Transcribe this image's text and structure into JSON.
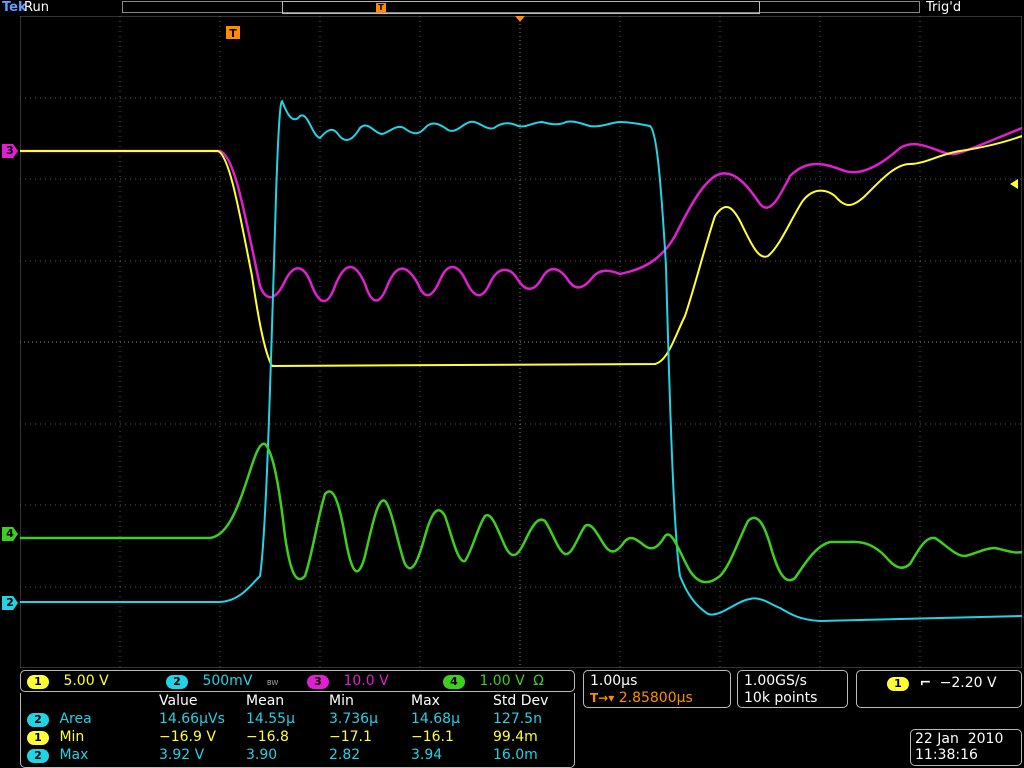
{
  "header": {
    "brand": "Tek",
    "run_state": "Run",
    "trigger_state": "Trig'd",
    "trigger_marker": "T"
  },
  "channels": [
    {
      "id": "1",
      "color": "#ffff33",
      "scale": "5.00 V"
    },
    {
      "id": "2",
      "color": "#22d3e6",
      "scale": "500mV",
      "bw": "BW"
    },
    {
      "id": "3",
      "color": "#e01fd0",
      "scale": "10.0 V"
    },
    {
      "id": "4",
      "color": "#3fce1f",
      "scale": "1.00 V",
      "unit": "Ω"
    }
  ],
  "measurements": {
    "headers": [
      "Value",
      "Mean",
      "Min",
      "Max",
      "Std Dev"
    ],
    "rows": [
      {
        "ch": "2",
        "name": "Area",
        "value": "14.66µVs",
        "mean": "14.55µ",
        "min": "3.736µ",
        "max": "14.68µ",
        "std": "127.5n"
      },
      {
        "ch": "1",
        "name": "Min",
        "value": "−16.9 V",
        "mean": "−16.8",
        "min": "−17.1",
        "max": "−16.1",
        "std": "99.4m"
      },
      {
        "ch": "2",
        "name": "Max",
        "value": "3.92 V",
        "mean": "3.90",
        "min": "2.82",
        "max": "3.94",
        "std": "16.0m"
      }
    ]
  },
  "timebase": {
    "scale": "1.00µs",
    "delay": "2.85800µs",
    "sample_rate": "1.00GS/s",
    "record_length": "10k points"
  },
  "trigger": {
    "source": "1",
    "slope_icon": "falling-edge-icon",
    "level": "−2.20 V"
  },
  "timestamp": {
    "date": "22 Jan  2010",
    "time": "11:38:16"
  }
}
